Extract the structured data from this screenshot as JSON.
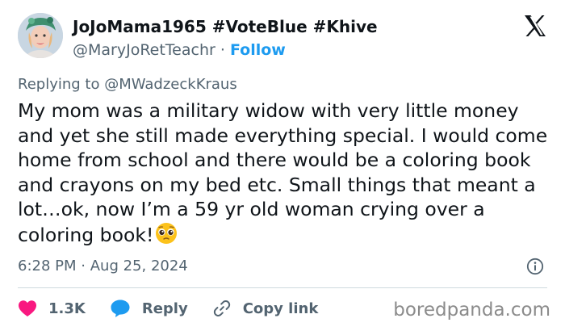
{
  "author": {
    "display_name": "JoJoMama1965 #VoteBlue #Khive",
    "handle": "@MaryJoRetTeachr",
    "separator": "·",
    "follow_label": "Follow"
  },
  "reply_to": {
    "label": "Replying to",
    "handle": "@MWadzeckKraus"
  },
  "tweet": {
    "text": "My mom was a military widow with very little money and yet she still made everything special. I would come home from school and there would be a coloring book and crayons on my bed etc. Small things that meant a lot…ok, now I’m a 59 yr old woman crying over a coloring book!",
    "emoji": "pleading-face-emoji",
    "time": "6:28 PM",
    "separator": "·",
    "date": "Aug 25, 2024"
  },
  "actions": {
    "like_count": "1.3K",
    "reply_label": "Reply",
    "copy_link_label": "Copy link"
  },
  "watermark": "boredpanda.com",
  "colors": {
    "link_blue": "#1d9bf0",
    "like_red": "#f91880",
    "reply_blue": "#1d9bf0",
    "secondary_text": "#536471"
  },
  "icons": [
    "x-logo-icon",
    "info-icon",
    "heart-icon",
    "speech-bubble-icon",
    "link-icon"
  ]
}
